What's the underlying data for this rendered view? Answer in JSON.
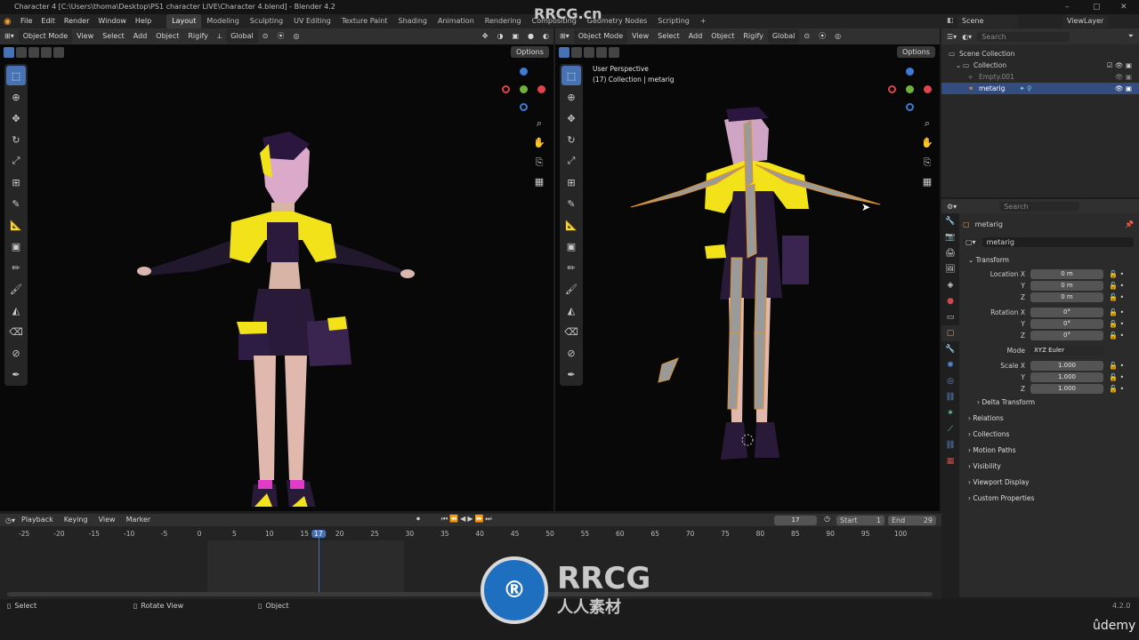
{
  "window": {
    "title": "Character 4 [C:\\Users\\thoma\\Desktop\\PS1 character LIVE\\Character 4.blend] - Blender 4.2",
    "controls": [
      "–",
      "▢",
      "✕"
    ]
  },
  "menubar": {
    "items": [
      "File",
      "Edit",
      "Render",
      "Window",
      "Help"
    ],
    "workspaces": [
      "Layout",
      "Modeling",
      "Sculpting",
      "UV Editing",
      "Texture Paint",
      "Shading",
      "Animation",
      "Rendering",
      "Compositing",
      "Geometry Nodes",
      "Scripting"
    ],
    "add_tab": "+",
    "scene_label": "Scene",
    "viewlayer_label": "ViewLayer"
  },
  "viewport_left": {
    "mode": "Object Mode",
    "menus": [
      "View",
      "Select",
      "Add",
      "Object",
      "Rigify"
    ],
    "orientation": "Global",
    "options": "Options"
  },
  "viewport_right": {
    "mode": "Object Mode",
    "menus": [
      "View",
      "Select",
      "Add",
      "Object",
      "Rigify"
    ],
    "orientation": "Global",
    "options": "Options",
    "perspective": "User Perspective",
    "collection_info": "(17) Collection | metarig"
  },
  "outliner": {
    "search_placeholder": "Search",
    "scene_collection": "Scene Collection",
    "collection": "Collection",
    "items": [
      "Empty.001",
      "metarig"
    ]
  },
  "properties": {
    "search_placeholder": "Search",
    "object_name": "metarig",
    "data_name": "metarig",
    "transform_label": "Transform",
    "location": {
      "label_x": "Location X",
      "x": "0 m",
      "y": "0 m",
      "z": "0 m"
    },
    "rotation": {
      "label_x": "Rotation X",
      "x": "0°",
      "y": "0°",
      "z": "0°"
    },
    "mode_label": "Mode",
    "mode_value": "XYZ Euler",
    "scale": {
      "label_x": "Scale X",
      "x": "1.000",
      "y": "1.000",
      "z": "1.000"
    },
    "axis_y": "Y",
    "axis_z": "Z",
    "delta_transform": "Delta Transform",
    "panels": [
      "Relations",
      "Collections",
      "Motion Paths",
      "Visibility",
      "Viewport Display",
      "Custom Properties"
    ]
  },
  "timeline": {
    "menus": [
      "Playback",
      "Keying",
      "View",
      "Marker"
    ],
    "current_frame": "17",
    "start_label": "Start",
    "start_value": "1",
    "end_label": "End",
    "end_value": "29",
    "ruler": [
      "-25",
      "-20",
      "-15",
      "-10",
      "-5",
      "0",
      "5",
      "10",
      "15",
      "17",
      "20",
      "25",
      "30",
      "35",
      "40",
      "45",
      "50",
      "55",
      "60",
      "65",
      "70",
      "75",
      "80",
      "85",
      "90",
      "95",
      "100"
    ]
  },
  "statusbar": {
    "select": "Select",
    "rotate_view": "Rotate View",
    "object": "Object",
    "version": "4.2.0",
    "udemy": "ûdemy"
  },
  "watermark": {
    "top": "RRCG.cn",
    "logo_main": "RRCG",
    "logo_sub": "人人素材"
  },
  "colors": {
    "accent": "#4772b3",
    "axis_x": "#e0434d",
    "axis_y": "#72b13a",
    "axis_z": "#3d7bd6",
    "jacket_yellow": "#f2e21a",
    "outfit_purple": "#2a1a3a"
  }
}
